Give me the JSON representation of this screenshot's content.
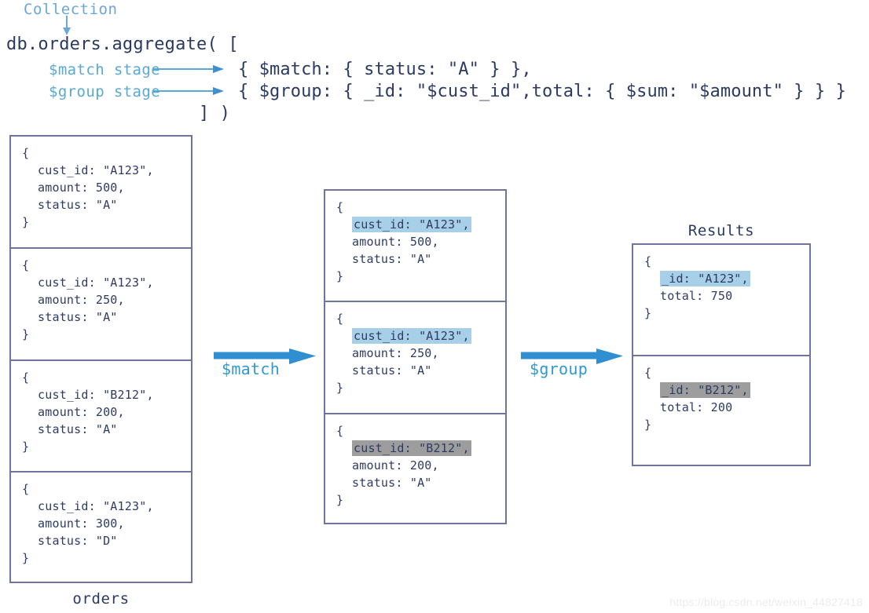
{
  "diagram": {
    "title": "MongoDB aggregation pipeline",
    "colors": {
      "box_border": "#70749c",
      "text": "#2e3b63",
      "annotation_blue": "#5aa8d6",
      "arrow_blue": "#2f8fd0",
      "highlight_blue": "#a8cfe8",
      "highlight_gray": "#9d9d9d"
    }
  },
  "code": {
    "collection_label": "Collection",
    "line_1": "db.orders.aggregate( [",
    "match_stage_label": "$match stage",
    "group_stage_label": "$group stage",
    "match_stage_code": "{ $match: { status: \"A\" } },",
    "group_stage_code": "{ $group: { _id: \"$cust_id\",total: { $sum: \"$amount\" } } }",
    "closing": "] )"
  },
  "orders": {
    "caption": "orders",
    "documents": [
      {
        "open": "{",
        "lines": [
          {
            "text": "cust_id: \"A123\",",
            "highlight": "none"
          },
          {
            "text": "amount: 500,",
            "highlight": "none"
          },
          {
            "text": "status: \"A\"",
            "highlight": "none"
          }
        ],
        "close": "}"
      },
      {
        "open": "{",
        "lines": [
          {
            "text": "cust_id: \"A123\",",
            "highlight": "none"
          },
          {
            "text": "amount: 250,",
            "highlight": "none"
          },
          {
            "text": "status: \"A\"",
            "highlight": "none"
          }
        ],
        "close": "}"
      },
      {
        "open": "{",
        "lines": [
          {
            "text": "cust_id: \"B212\",",
            "highlight": "none"
          },
          {
            "text": "amount: 200,",
            "highlight": "none"
          },
          {
            "text": "status: \"A\"",
            "highlight": "none"
          }
        ],
        "close": "}"
      },
      {
        "open": "{",
        "lines": [
          {
            "text": "cust_id: \"A123\",",
            "highlight": "none"
          },
          {
            "text": "amount: 300,",
            "highlight": "none"
          },
          {
            "text": "status: \"D\"",
            "highlight": "none"
          }
        ],
        "close": "}"
      }
    ]
  },
  "matched": {
    "caption": "",
    "documents": [
      {
        "open": "{",
        "lines": [
          {
            "text": "cust_id: \"A123\",",
            "highlight": "blue"
          },
          {
            "text": "amount: 500,",
            "highlight": "none"
          },
          {
            "text": "status: \"A\"",
            "highlight": "none"
          }
        ],
        "close": "}"
      },
      {
        "open": "{",
        "lines": [
          {
            "text": "cust_id: \"A123\",",
            "highlight": "blue"
          },
          {
            "text": "amount: 250,",
            "highlight": "none"
          },
          {
            "text": "status: \"A\"",
            "highlight": "none"
          }
        ],
        "close": "}"
      },
      {
        "open": "{",
        "lines": [
          {
            "text": "cust_id: \"B212\",",
            "highlight": "gray"
          },
          {
            "text": "amount: 200,",
            "highlight": "none"
          },
          {
            "text": "status: \"A\"",
            "highlight": "none"
          }
        ],
        "close": "}"
      }
    ]
  },
  "results": {
    "caption": "Results",
    "documents": [
      {
        "open": "{",
        "lines": [
          {
            "text": "_id: \"A123\",",
            "highlight": "blue"
          },
          {
            "text": "total: 750",
            "highlight": "none"
          }
        ],
        "close": "}"
      },
      {
        "open": "{",
        "lines": [
          {
            "text": "_id: \"B212\",",
            "highlight": "gray"
          },
          {
            "text": "total: 200",
            "highlight": "none"
          }
        ],
        "close": "}"
      }
    ]
  },
  "pipeline": {
    "match_label": "$match",
    "group_label": "$group"
  },
  "watermark": {
    "text": "https://blog.csdn.net/weixin_44827418"
  }
}
